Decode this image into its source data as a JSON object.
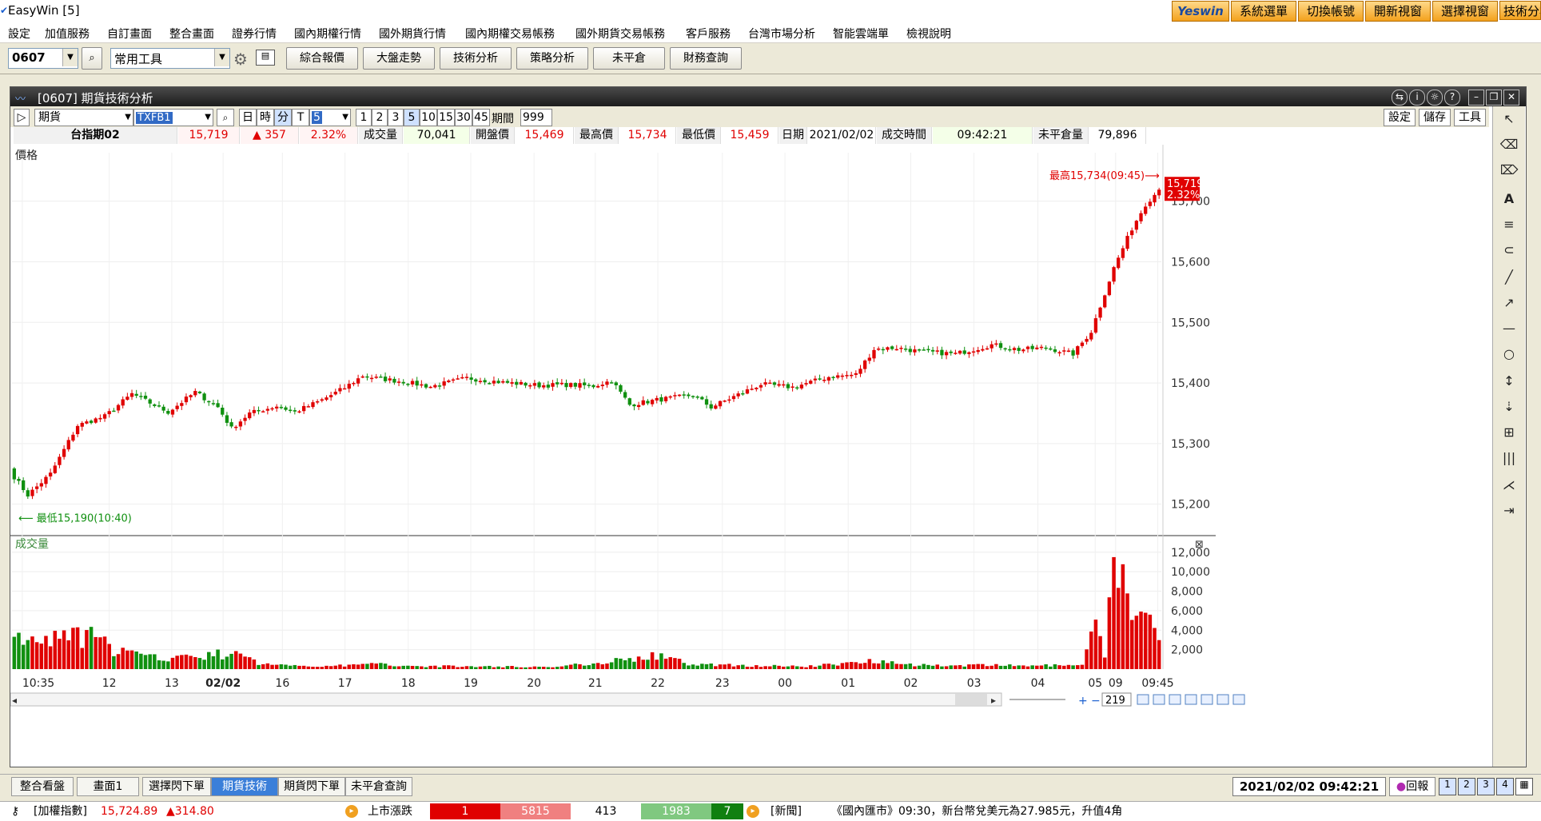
{
  "app": {
    "title": "EasyWin  [5]"
  },
  "topbar": {
    "brand": "Yeswin",
    "buttons": [
      "系統選單",
      "切換帳號",
      "開新視窗",
      "選擇視窗",
      "技術分析"
    ]
  },
  "menu": [
    "設定",
    "加值服務",
    "自訂畫面",
    "整合畫面",
    "證券行情",
    "國內期權行情",
    "國外期貨行情",
    "國內期權交易帳務",
    "國外期貨交易帳務",
    "客戶服務",
    "台灣市場分析",
    "智能雲端單",
    "檢視說明"
  ],
  "toolbar": {
    "code": "0607",
    "tool_combo": "常用工具",
    "buttons": [
      "綜合報價",
      "大盤走勢",
      "技術分析",
      "策略分析",
      "未平倉",
      "財務查詢"
    ]
  },
  "window": {
    "title": "[0607] 期貨技術分析"
  },
  "controls": {
    "type_value": "期貨",
    "symbol_value": "TXFB1",
    "periods": [
      "日",
      "時",
      "分",
      "T"
    ],
    "minute_value": "5",
    "quick_minutes": [
      "1",
      "2",
      "3",
      "5",
      "10",
      "15",
      "30",
      "45"
    ],
    "period_label": "期間",
    "period_value": "999",
    "right_buttons": [
      "設定",
      "儲存",
      "工具"
    ]
  },
  "quote": {
    "name": "台指期02",
    "price": "15,719",
    "change": "▲ 357",
    "pct": "2.32%",
    "vol_label": "成交量",
    "vol": "70,041",
    "open_label": "開盤價",
    "open": "15,469",
    "high_label": "最高價",
    "high": "15,734",
    "low_label": "最低價",
    "low": "15,459",
    "date_label": "日期",
    "date": "2021/02/02",
    "time_label": "成交時間",
    "time": "09:42:21",
    "oi_label": "未平倉量",
    "oi": "79,896"
  },
  "chart_data": {
    "type": "candlestick",
    "price_panel_label": "價格",
    "volume_panel_label": "成交量",
    "price_ticks": [
      "15,200",
      "15,300",
      "15,400",
      "15,500",
      "15,600",
      "15,700"
    ],
    "ylim": [
      15160,
      15780
    ],
    "volume_ticks": [
      "2,000",
      "4,000",
      "6,000",
      "8,000",
      "10,000",
      "12,000"
    ],
    "vol_ylim": [
      0,
      12800
    ],
    "x_ticks": [
      "10:35",
      "12",
      "13",
      "02/02",
      "16",
      "17",
      "18",
      "19",
      "20",
      "21",
      "22",
      "23",
      "00",
      "01",
      "02",
      "03",
      "04",
      "05",
      "09",
      "09:45"
    ],
    "high_annotation": "最高15,734(09:45)⟶",
    "low_annotation": "⟵ 最低15,190(10:40)",
    "last_price": "15,719",
    "last_pct": "2.32%",
    "zoom_value": "219",
    "colors": {
      "up": "#e00000",
      "down": "#109010"
    },
    "close_path": [
      [
        0,
        15245
      ],
      [
        3,
        15215
      ],
      [
        8,
        15250
      ],
      [
        14,
        15330
      ],
      [
        20,
        15345
      ],
      [
        26,
        15382
      ],
      [
        34,
        15352
      ],
      [
        40,
        15385
      ],
      [
        45,
        15360
      ],
      [
        48,
        15325
      ],
      [
        52,
        15350
      ],
      [
        58,
        15362
      ],
      [
        62,
        15352
      ],
      [
        68,
        15372
      ],
      [
        73,
        15392
      ],
      [
        77,
        15412
      ],
      [
        80,
        15408
      ],
      [
        86,
        15402
      ],
      [
        92,
        15394
      ],
      [
        100,
        15408
      ],
      [
        108,
        15401
      ],
      [
        116,
        15396
      ],
      [
        122,
        15397
      ],
      [
        128,
        15395
      ],
      [
        132,
        15404
      ],
      [
        136,
        15364
      ],
      [
        142,
        15372
      ],
      [
        150,
        15380
      ],
      [
        154,
        15360
      ],
      [
        158,
        15374
      ],
      [
        165,
        15398
      ],
      [
        172,
        15393
      ],
      [
        180,
        15410
      ],
      [
        186,
        15414
      ],
      [
        190,
        15456
      ],
      [
        195,
        15458
      ],
      [
        200,
        15452
      ],
      [
        208,
        15448
      ],
      [
        216,
        15463
      ],
      [
        222,
        15455
      ],
      [
        228,
        15458
      ],
      [
        234,
        15448
      ],
      [
        238,
        15485
      ],
      [
        243,
        15590
      ],
      [
        247,
        15655
      ],
      [
        250,
        15695
      ],
      [
        253,
        15719
      ]
    ],
    "volume_profile": [
      [
        0,
        2900
      ],
      [
        10,
        3200
      ],
      [
        16,
        3700
      ],
      [
        22,
        2100
      ],
      [
        30,
        1200
      ],
      [
        40,
        1300
      ],
      [
        48,
        1700
      ],
      [
        55,
        500
      ],
      [
        70,
        320
      ],
      [
        80,
        550
      ],
      [
        90,
        320
      ],
      [
        120,
        240
      ],
      [
        138,
        1200
      ],
      [
        142,
        1400
      ],
      [
        150,
        500
      ],
      [
        175,
        280
      ],
      [
        186,
        700
      ],
      [
        190,
        1000
      ],
      [
        200,
        420
      ],
      [
        236,
        380
      ],
      [
        239,
        4500
      ],
      [
        241,
        1200
      ],
      [
        243,
        11000
      ],
      [
        245,
        9200
      ],
      [
        247,
        7200
      ],
      [
        249,
        5400
      ],
      [
        251,
        4600
      ],
      [
        253,
        3100
      ]
    ]
  },
  "tabs": [
    "整合看盤",
    "畫面1",
    "選擇閃下單",
    "期貨技術",
    "期貨閃下單",
    "未平倉查詢"
  ],
  "clock": "2021/02/02 09:42:21",
  "status": {
    "index_label": "[加權指數]",
    "index_value": "15,724.89",
    "index_change": "▲314.80",
    "market_label": "上市漲跌",
    "m1": "1",
    "m2": "5815",
    "m3": "413",
    "m4": "1983",
    "m5": "7",
    "news_label": "[新聞]",
    "news": "《國內匯市》09:30，新台幣兌美元為27.985元，升值4角",
    "back_label": "回報"
  }
}
